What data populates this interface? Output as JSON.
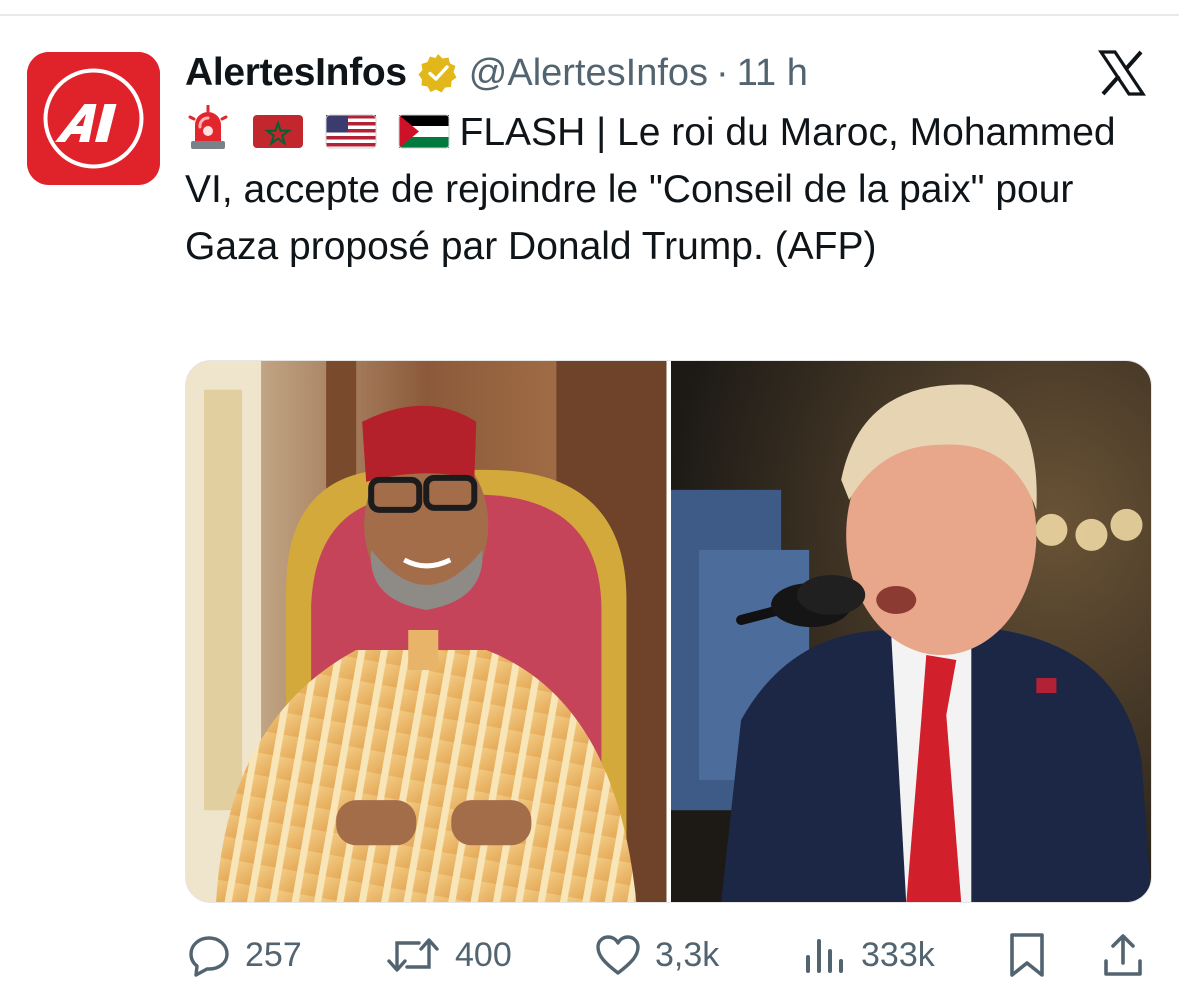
{
  "post": {
    "author_name": "AlertesInfos",
    "author_handle": "@AlertesInfos",
    "separator": "·",
    "timestamp": "11 h",
    "avatar_text": "AI",
    "emojis": [
      "rotating-light-emoji",
      "flag-morocco-emoji",
      "flag-usa-emoji",
      "flag-palestine-emoji"
    ],
    "text": "FLASH | Le roi du Maroc, Mohammed VI, accepte de rejoindre le \"Conseil de la paix\" pour Gaza proposé par Donald Trump. (AFP)",
    "images": [
      "photo-mohammed-vi",
      "photo-donald-trump"
    ]
  },
  "actions": {
    "replies": "257",
    "reposts": "400",
    "likes": "3,3k",
    "views": "333k"
  },
  "colors": {
    "brand_red": "#e0232a",
    "verified_gold": "#e2b719",
    "text": "#0f1419",
    "muted": "#536471"
  }
}
